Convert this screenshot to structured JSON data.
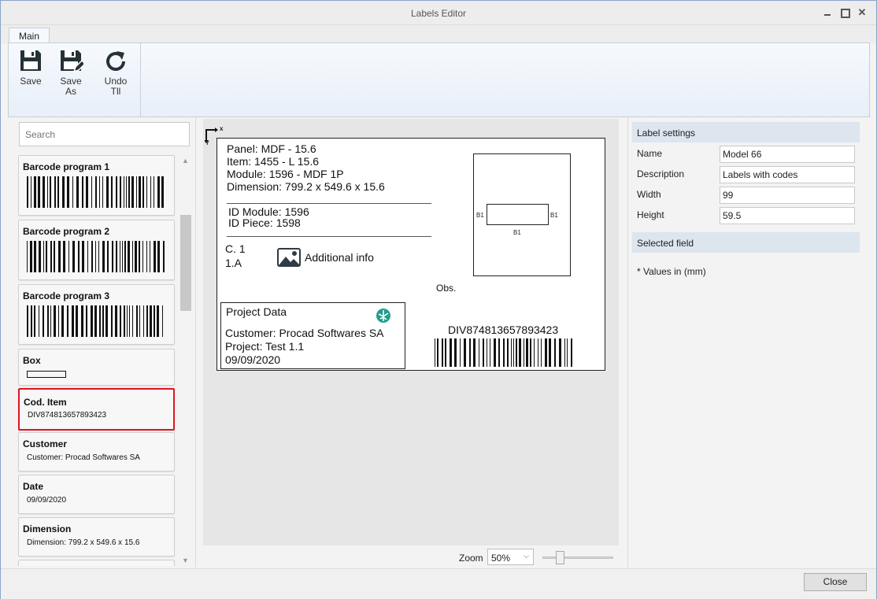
{
  "window": {
    "title": "Labels Editor"
  },
  "ribbon": {
    "tab": "Main",
    "buttons": [
      {
        "line1": "Save",
        "line2": ""
      },
      {
        "line1": "Save",
        "line2": "As"
      },
      {
        "line1": "Undo",
        "line2": "Tll"
      }
    ]
  },
  "search": {
    "placeholder": "Search"
  },
  "items": [
    {
      "title": "Barcode program 1"
    },
    {
      "title": "Barcode program 2"
    },
    {
      "title": "Barcode program 3"
    },
    {
      "title": "Box"
    },
    {
      "title": "Cod. Item",
      "value": "DIV874813657893423"
    },
    {
      "title": "Customer",
      "value": "Customer: Procad Softwares SA"
    },
    {
      "title": "Date",
      "value": "09/09/2020"
    },
    {
      "title": "Dimension",
      "value": "Dimension: 799.2 x 549.6 x 15.6"
    }
  ],
  "label": {
    "axis_x": "x",
    "axis_y": "Y",
    "panel": "Panel: MDF - 15.6",
    "item": "Item: 1455 - L 15.6",
    "module": "Module: 1596 - MDF 1P",
    "dimension": "Dimension: 799.2 x 549.6 x 15.6",
    "id_module": "ID Module: 1596",
    "id_piece": "ID Piece: 1598",
    "c": "C. 1",
    "a": "1.A",
    "additional_info": "Additional info",
    "obs": "Obs.",
    "project_title": "Project Data",
    "customer": "Customer: Procad Softwares SA",
    "project": "Project: Test 1.1",
    "date": "09/09/2020",
    "code": "DIV874813657893423",
    "b_left": "B1",
    "b_right": "B1",
    "b_bottom": "B1"
  },
  "zoom": {
    "label": "Zoom",
    "value": "50%",
    "level": 0.2
  },
  "settings": {
    "section_title": "Label settings",
    "name_label": "Name",
    "name_value": "Model 66",
    "description_label": "Description",
    "description_value": "Labels with codes",
    "width_label": "Width",
    "width_value": "99",
    "height_label": "Height",
    "height_value": "59.5",
    "selected_field_title": "Selected field",
    "note": "* Values in (mm)"
  },
  "footer": {
    "close": "Close"
  },
  "colors": {
    "selected_border": "#e0141e",
    "section_bg": "#dde5ef",
    "accent_icon": "#1f9e8e"
  }
}
